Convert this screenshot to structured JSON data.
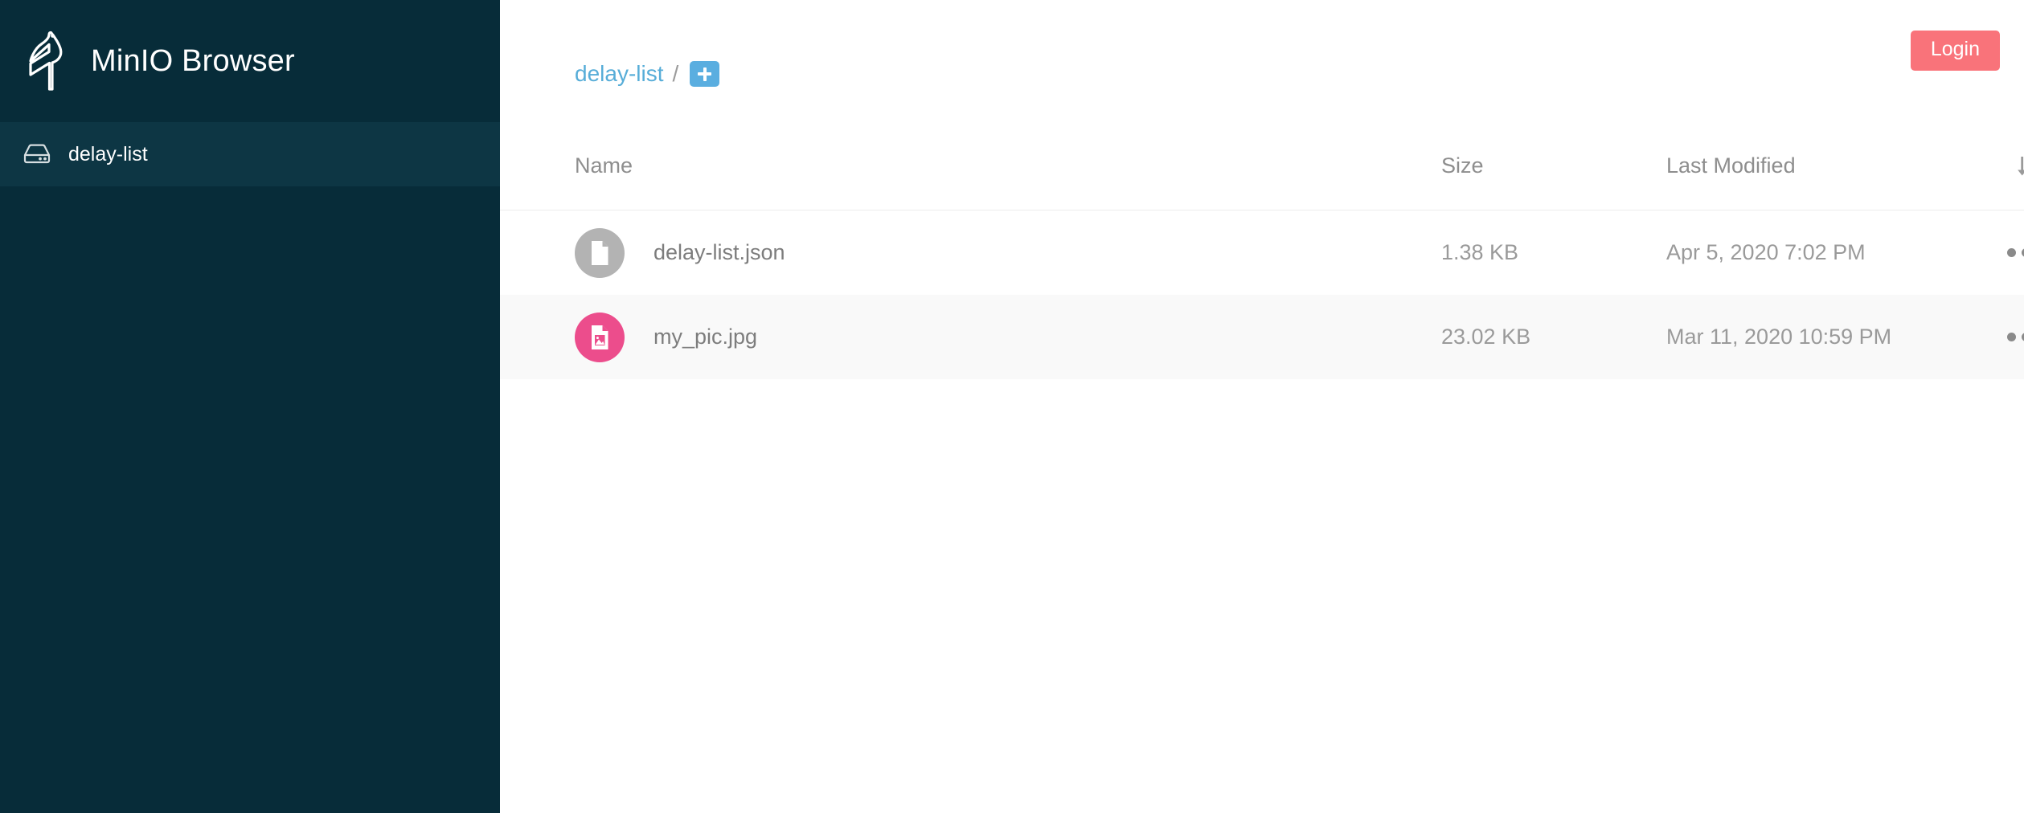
{
  "sidebar": {
    "brand_title": "MinIO Browser",
    "logo_icon": "minio-stork-logo",
    "buckets": [
      {
        "label": "delay-list",
        "icon": "hdd-icon",
        "active": true
      }
    ]
  },
  "topbar": {
    "breadcrumb": {
      "root_label": "delay-list",
      "separator": "/"
    },
    "new_folder_icon": "folder-plus-icon",
    "login_label": "Login"
  },
  "table": {
    "columns": {
      "name": "Name",
      "size": "Size",
      "last_modified": "Last Modified"
    },
    "sort_icon": "sort-numeric-down-icon",
    "rows": [
      {
        "icon": "file-document-icon",
        "name": "delay-list.json",
        "size": "1.38 KB",
        "last_modified": "Apr 5, 2020 7:02 PM",
        "actions_icon": "ellipsis-horizontal-icon"
      },
      {
        "icon": "file-image-icon",
        "name": "my_pic.jpg",
        "size": "23.02 KB",
        "last_modified": "Mar 11, 2020 10:59 PM",
        "actions_icon": "ellipsis-horizontal-icon"
      }
    ]
  },
  "colors": {
    "sidebar_bg": "#072c39",
    "sidebar_active_bg": "#0d3644",
    "breadcrumb_link": "#57add8",
    "new_folder_btn": "#5aaee0",
    "login_btn": "#f9737a",
    "doc_badge": "#b3b3b3",
    "image_badge": "#ec4d8c",
    "row_shade": "#f9f9f9"
  }
}
